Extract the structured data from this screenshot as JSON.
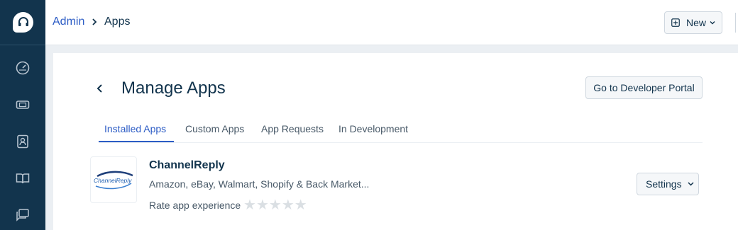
{
  "breadcrumb": {
    "root": "Admin",
    "current": "Apps"
  },
  "header": {
    "new_label": "New"
  },
  "page": {
    "title": "Manage Apps",
    "portal_button": "Go to Developer Portal"
  },
  "tabs": [
    {
      "label": "Installed Apps",
      "active": true
    },
    {
      "label": "Custom Apps",
      "active": false
    },
    {
      "label": "App Requests",
      "active": false
    },
    {
      "label": "In Development",
      "active": false
    }
  ],
  "app": {
    "name": "ChannelReply",
    "logo_text": "ChannelReply",
    "description": "Amazon, eBay, Walmart, Shopify & Back Market...",
    "rate_label": "Rate app experience",
    "rating": 0,
    "rating_max": 5,
    "settings_label": "Settings"
  },
  "colors": {
    "sidebar": "#12344d",
    "accent": "#2c5cc5",
    "background": "#ebeff3"
  }
}
